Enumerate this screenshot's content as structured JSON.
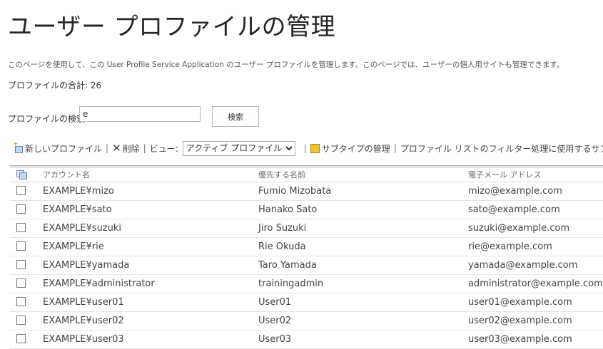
{
  "page": {
    "title": "ユーザー プロファイルの管理",
    "description": "このページを使用して、この User Profile Service Application のユーザー プロファイルを管理します。このページでは、ユーザーの個人用サイトも管理できます。",
    "total": "プロファイルの合計: 26"
  },
  "search": {
    "label": "プロファイルの検索",
    "value": "e",
    "button": "検索"
  },
  "toolbar": {
    "new_profile": "新しいプロファイル",
    "delete": "削除",
    "view_label": "ビュー:",
    "view_selected": "アクティブ プロファイル",
    "subtype": "サブタイプの管理",
    "filter_text": "プロファイル リストのフィルター処理に使用するサブ"
  },
  "table": {
    "headers": {
      "account": "アカウント名",
      "preferred_name": "優先する名前",
      "email": "電子メール アドレス"
    },
    "rows": [
      {
        "account": "EXAMPLE¥mizo",
        "name": "Fumio Mizobata",
        "email": "mizo@example.com"
      },
      {
        "account": "EXAMPLE¥sato",
        "name": "Hanako Sato",
        "email": "sato@example.com"
      },
      {
        "account": "EXAMPLE¥suzuki",
        "name": "Jiro Suzuki",
        "email": "suzuki@example.com"
      },
      {
        "account": "EXAMPLE¥rie",
        "name": "Rie Okuda",
        "email": "rie@example.com"
      },
      {
        "account": "EXAMPLE¥yamada",
        "name": "Taro Yamada",
        "email": "yamada@example.com"
      },
      {
        "account": "EXAMPLE¥administrator",
        "name": "trainingadmin",
        "email": "administrator@example.com"
      },
      {
        "account": "EXAMPLE¥user01",
        "name": "User01",
        "email": "user01@example.com"
      },
      {
        "account": "EXAMPLE¥user02",
        "name": "User02",
        "email": "user02@example.com"
      },
      {
        "account": "EXAMPLE¥user03",
        "name": "User03",
        "email": "user03@example.com"
      }
    ]
  },
  "icons": {
    "new_profile": "new-profile-icon",
    "delete": "delete-x-icon",
    "subtype": "subtype-folder-icon",
    "select_all": "select-all-icon"
  }
}
